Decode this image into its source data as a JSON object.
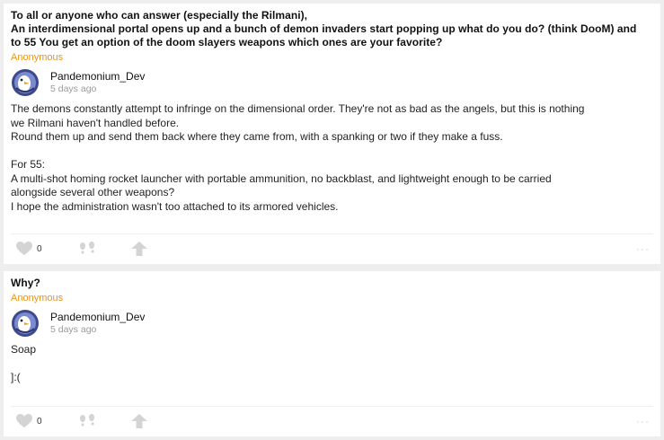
{
  "posts": [
    {
      "question_lines": [
        "To all or anyone who can answer (especially the Rilmani),",
        "An interdimensional portal opens up and a bunch of demon invaders start popping up what do you do? (think DooM) and",
        "to 55 You get an option of the doom slayers weapons which ones are your favorite?"
      ],
      "asker": "Anonymous",
      "answer": {
        "author": "Pandemonium_Dev",
        "time": "5 days ago",
        "paragraphs": [
          [
            "The demons constantly attempt to infringe on the dimensional order. They're not as bad as the angels, but this is nothing",
            "we Rilmani haven't handled before.",
            "Round them up and send them back where they came from, with a spanking or two if they make a fuss."
          ],
          [
            "For 55:",
            "A multi-shot homing rocket launcher with portable ammunition, no backblast, and lightweight enough to be carried",
            "alongside several other weapons?",
            "I hope the administration wasn't too attached to its armored vehicles."
          ]
        ]
      },
      "likes": "0"
    },
    {
      "question_lines": [
        "Why?"
      ],
      "asker": "Anonymous",
      "answer": {
        "author": "Pandemonium_Dev",
        "time": "5 days ago",
        "paragraphs": [
          [
            "Soap"
          ],
          [
            "]:("
          ]
        ]
      },
      "likes": "0"
    }
  ],
  "icons": {
    "like": "heart-icon",
    "dislike": "thumbs-down-icon",
    "share": "share-arrow-icon",
    "more": "ellipsis-icon",
    "avatar": "penguin-avatar"
  },
  "colors": {
    "asker": "#e8941a",
    "icon": "#d0d0d0",
    "background": "#eeeeee"
  },
  "more_label": "···"
}
